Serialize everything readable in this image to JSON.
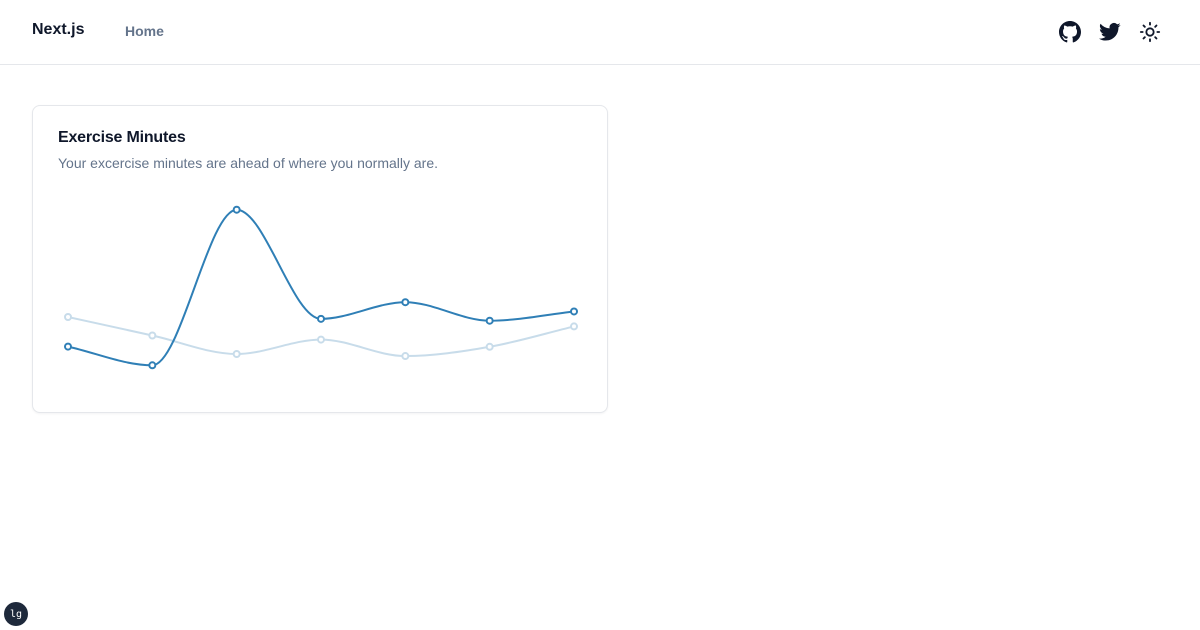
{
  "header": {
    "brand": "Next.js",
    "nav": [
      {
        "label": "Home"
      }
    ],
    "icons": [
      "github-icon",
      "twitter-icon",
      "sun-icon"
    ]
  },
  "card": {
    "title": "Exercise Minutes",
    "description": "Your excercise minutes are ahead of where you normally are."
  },
  "colors": {
    "primary": "#2f7fb6",
    "secondary": "#c8dcea",
    "muted_text": "#64748b",
    "foreground": "#0f172a",
    "border": "#e5e7eb"
  },
  "chart_data": {
    "type": "line",
    "x": [
      1,
      2,
      3,
      4,
      5,
      6,
      7
    ],
    "series": [
      {
        "values": [
          240,
          139,
          980,
          390,
          480,
          380,
          430
        ]
      },
      {
        "values": [
          400,
          300,
          200,
          278,
          189,
          239,
          349
        ]
      }
    ],
    "ylim": [
      0,
      1000
    ],
    "grid": false,
    "legend": "none"
  },
  "dev_indicator": "lg"
}
